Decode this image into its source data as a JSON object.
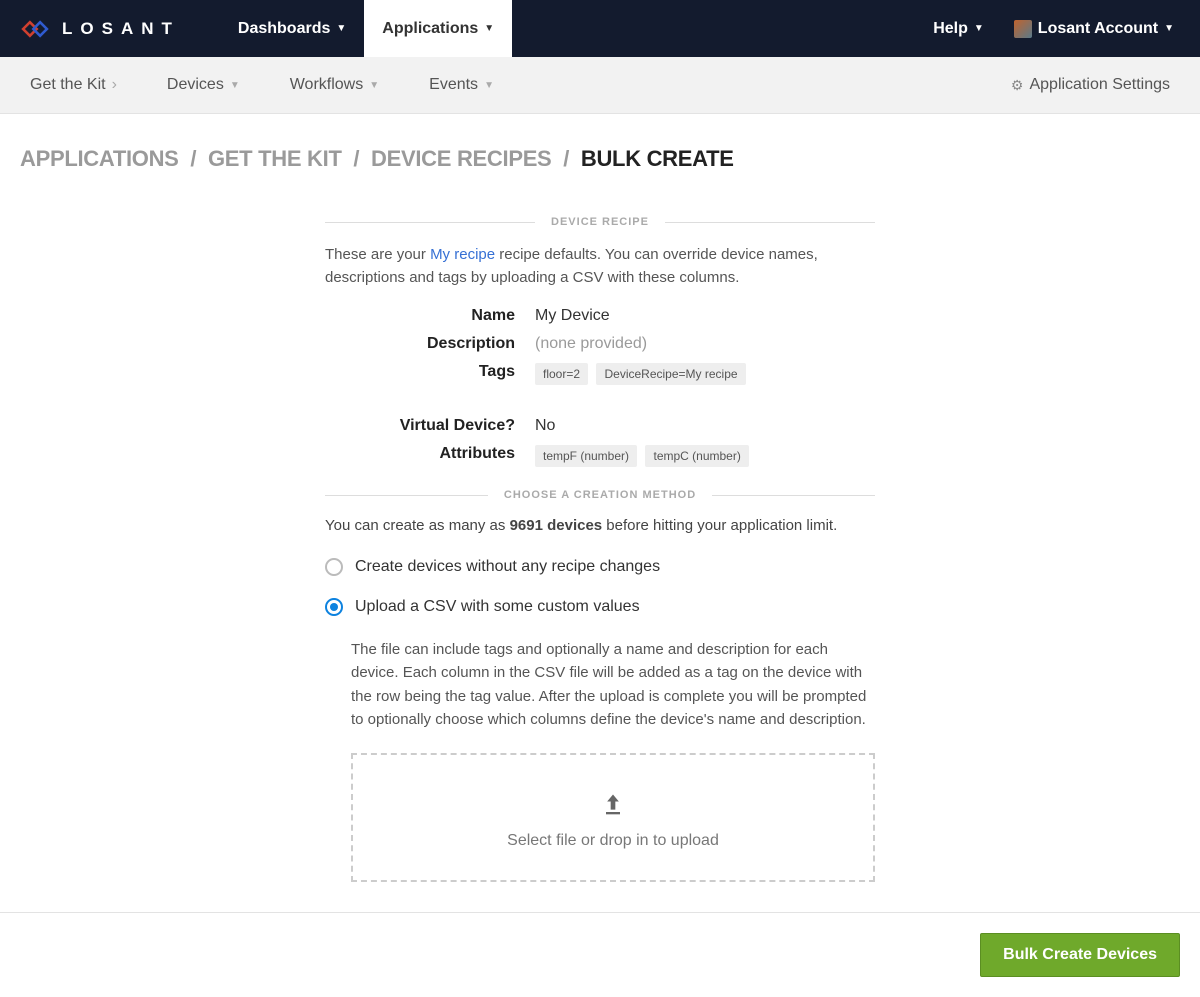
{
  "brand": "LOSANT",
  "topnav": {
    "dashboards": "Dashboards",
    "applications": "Applications",
    "help": "Help",
    "account": "Losant Account"
  },
  "subnav": {
    "get_the_kit": "Get the Kit",
    "devices": "Devices",
    "workflows": "Workflows",
    "events": "Events",
    "settings": "Application Settings"
  },
  "breadcrumb": {
    "applications": "Applications",
    "app": "Get the Kit",
    "recipes": "Device Recipes",
    "current": "Bulk Create"
  },
  "section": {
    "device_recipe": "Device Recipe",
    "choose_method": "Choose a Creation Method"
  },
  "intro": {
    "prefix": "These are your ",
    "link": "My recipe",
    "suffix": " recipe defaults. You can override device names, descriptions and tags by uploading a CSV with these columns."
  },
  "recipe": {
    "labels": {
      "name": "Name",
      "description": "Description",
      "tags": "Tags",
      "virtual": "Virtual Device?",
      "attributes": "Attributes"
    },
    "name": "My Device",
    "description": "(none provided)",
    "tags": [
      "floor=2",
      "DeviceRecipe=My recipe"
    ],
    "virtual": "No",
    "attributes": [
      "tempF (number)",
      "tempC (number)"
    ]
  },
  "limit": {
    "prefix": "You can create as many as ",
    "count": "9691 devices",
    "suffix": " before hitting your application limit."
  },
  "methods": {
    "no_changes": "Create devices without any recipe changes",
    "upload_csv": "Upload a CSV with some custom values",
    "upload_help": "The file can include tags and optionally a name and description for each device. Each column in the CSV file will be added as a tag on the device with the row being the tag value. After the upload is complete you will be prompted to optionally choose which columns define the device's name and description.",
    "dropzone": "Select file or drop in to upload"
  },
  "footer": {
    "submit": "Bulk Create Devices"
  }
}
